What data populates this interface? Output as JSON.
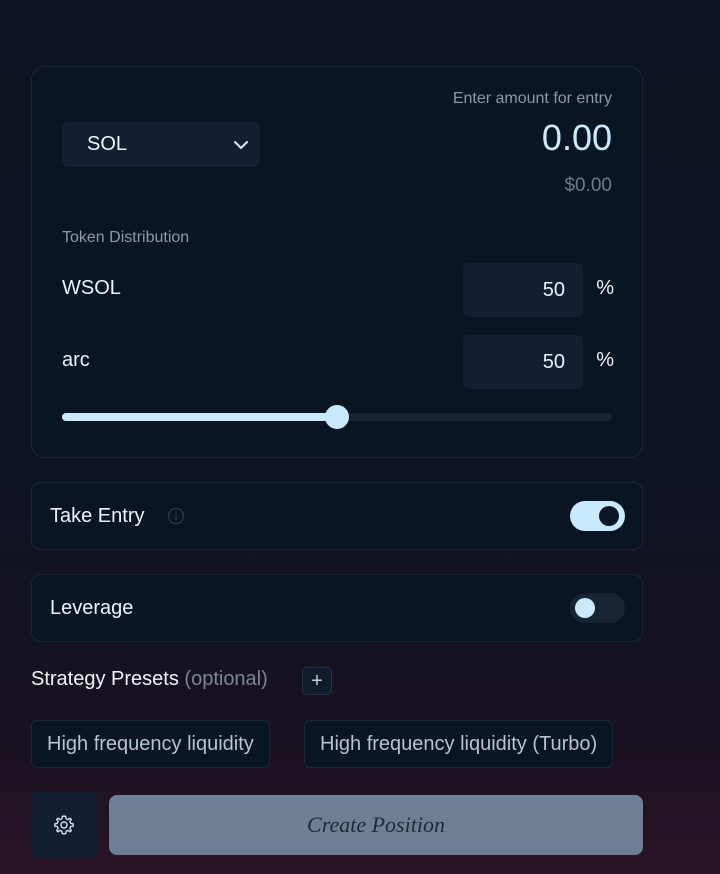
{
  "entry": {
    "token": "SOL",
    "label": "Enter amount for entry",
    "amount": "0.00",
    "usd_value": "$0.00"
  },
  "distribution": {
    "label": "Token Distribution",
    "tokens": [
      {
        "name": "WSOL",
        "value": "50",
        "unit": "%"
      },
      {
        "name": "arc",
        "value": "50",
        "unit": "%"
      }
    ],
    "slider_fraction": 0.5
  },
  "options": {
    "take_entry": {
      "label": "Take Entry",
      "enabled": true,
      "info_icon": "info-icon"
    },
    "leverage": {
      "label": "Leverage",
      "enabled": false
    }
  },
  "presets": {
    "title": "Strategy Presets",
    "optional_label": "(optional)",
    "add_label": "+",
    "items": [
      "High frequency liquidity",
      "High frequency liquidity (Turbo)"
    ]
  },
  "actions": {
    "settings_icon": "gear-icon",
    "create_label": "Create Position"
  },
  "colors": {
    "accent": "#c9e9ff",
    "card_bg": "#0a1524",
    "create_button_bg": "#6e7f95"
  }
}
